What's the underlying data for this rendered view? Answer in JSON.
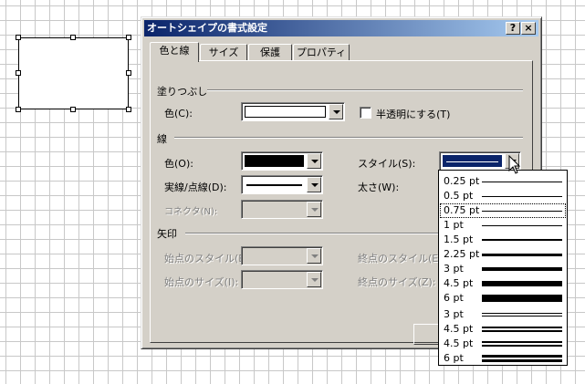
{
  "dialog": {
    "title": "オートシェイプの書式設定",
    "help_button": "?",
    "close_button": "×",
    "tabs": [
      {
        "label": "色と線"
      },
      {
        "label": "サイズ"
      },
      {
        "label": "保護"
      },
      {
        "label": "プロパティ"
      }
    ],
    "fill": {
      "section": "塗りつぶし",
      "color_label": "色(C):",
      "color_value": "#ffffff",
      "transparent_label": "半透明にする(T)"
    },
    "line": {
      "section": "線",
      "color_label": "色(O):",
      "color_value": "#000000",
      "dash_label": "実線/点線(D):",
      "connector_label": "コネクタ(N):",
      "style_label": "スタイル(S):",
      "weight_label": "太さ(W):"
    },
    "arrows": {
      "section": "矢印",
      "begin_style": "始点のスタイル(B):",
      "end_style": "終点のスタイル(E):",
      "begin_size": "始点のサイズ(I):",
      "end_size": "終点のサイズ(Z):"
    }
  },
  "style_dropdown": {
    "items": [
      {
        "label": "0.25 pt",
        "weight": 0.25,
        "double": false
      },
      {
        "label": "0.5 pt",
        "weight": 0.5,
        "double": false
      },
      {
        "label": "0.75 pt",
        "weight": 0.75,
        "double": false,
        "selected": true
      },
      {
        "label": "1 pt",
        "weight": 1,
        "double": false
      },
      {
        "label": "1.5 pt",
        "weight": 1.5,
        "double": false
      },
      {
        "label": "2.25 pt",
        "weight": 2.25,
        "double": false
      },
      {
        "label": "3 pt",
        "weight": 3,
        "double": false
      },
      {
        "label": "4.5 pt",
        "weight": 4.5,
        "double": false
      },
      {
        "label": "6 pt",
        "weight": 6,
        "double": false
      },
      {
        "label": "3 pt",
        "weight": 3,
        "double": true
      },
      {
        "label": "4.5 pt",
        "weight": 4.5,
        "double": true
      },
      {
        "label": "4.5 pt",
        "weight": 4.5,
        "double": true
      },
      {
        "label": "6 pt",
        "weight": 6,
        "double": true
      }
    ]
  },
  "colors": {
    "titlebar_start": "#0a246a",
    "titlebar_end": "#a6caf0",
    "dialog_face": "#d4d0c8",
    "selection": "#0a246a"
  }
}
